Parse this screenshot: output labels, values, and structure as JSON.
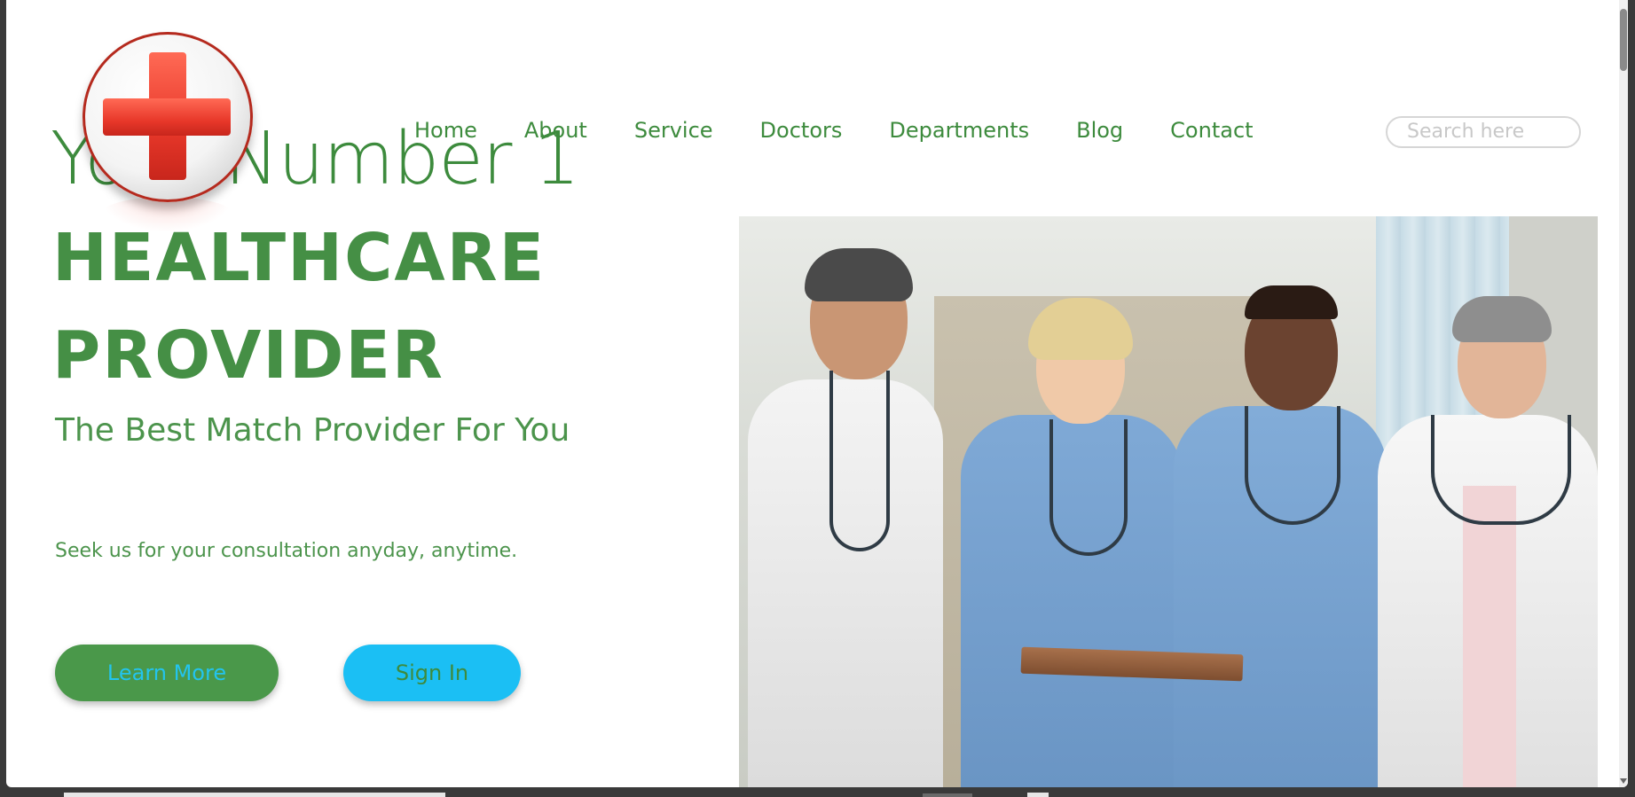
{
  "nav": {
    "items": [
      "Home",
      "About",
      "Service",
      "Doctors",
      "Departments",
      "Blog",
      "Contact"
    ]
  },
  "search": {
    "placeholder": "Search here"
  },
  "hero": {
    "line1": "Your Number 1",
    "line2": "HEALTHCARE",
    "line3": "PROVIDER",
    "subtitle": "The Best Match Provider For You",
    "tagline": "Seek us for your consultation anyday, anytime."
  },
  "buttons": {
    "learn_more": "Learn More",
    "sign_in": "Sign In"
  },
  "colors": {
    "brand_green": "#3d8b3d",
    "button_green": "#4a984a",
    "button_cyan": "#1bbff4",
    "logo_red": "#e8382a"
  },
  "icons": {
    "logo": "medical-cross-icon"
  },
  "images": {
    "hero_photo": "medical-team-photo"
  }
}
